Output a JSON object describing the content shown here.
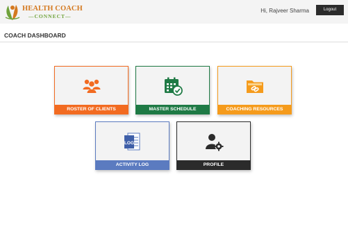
{
  "header": {
    "logo_line1": "HEALTH COACH",
    "logo_line2": "—CONNECT—",
    "greeting": "Hi, Rajveer Sharma",
    "logout_label": "Logout"
  },
  "page": {
    "title": "COACH DASHBOARD"
  },
  "tiles": [
    {
      "label": "ROSTER OF CLIENTS",
      "icon": "group-icon",
      "color": "#f26b21"
    },
    {
      "label": "MASTER SCHEDULE",
      "icon": "calendar-check-icon",
      "color": "#1f7a45"
    },
    {
      "label": "COACHING RESOURCES",
      "icon": "folder-link-icon",
      "color": "#f59b1c"
    },
    {
      "label": "ACTIVITY LOG",
      "icon": "log-book-icon",
      "color": "#5b7bc0",
      "icon_text": "LOG"
    },
    {
      "label": "PROFILE",
      "icon": "user-gear-icon",
      "color": "#2b2b2b"
    }
  ]
}
